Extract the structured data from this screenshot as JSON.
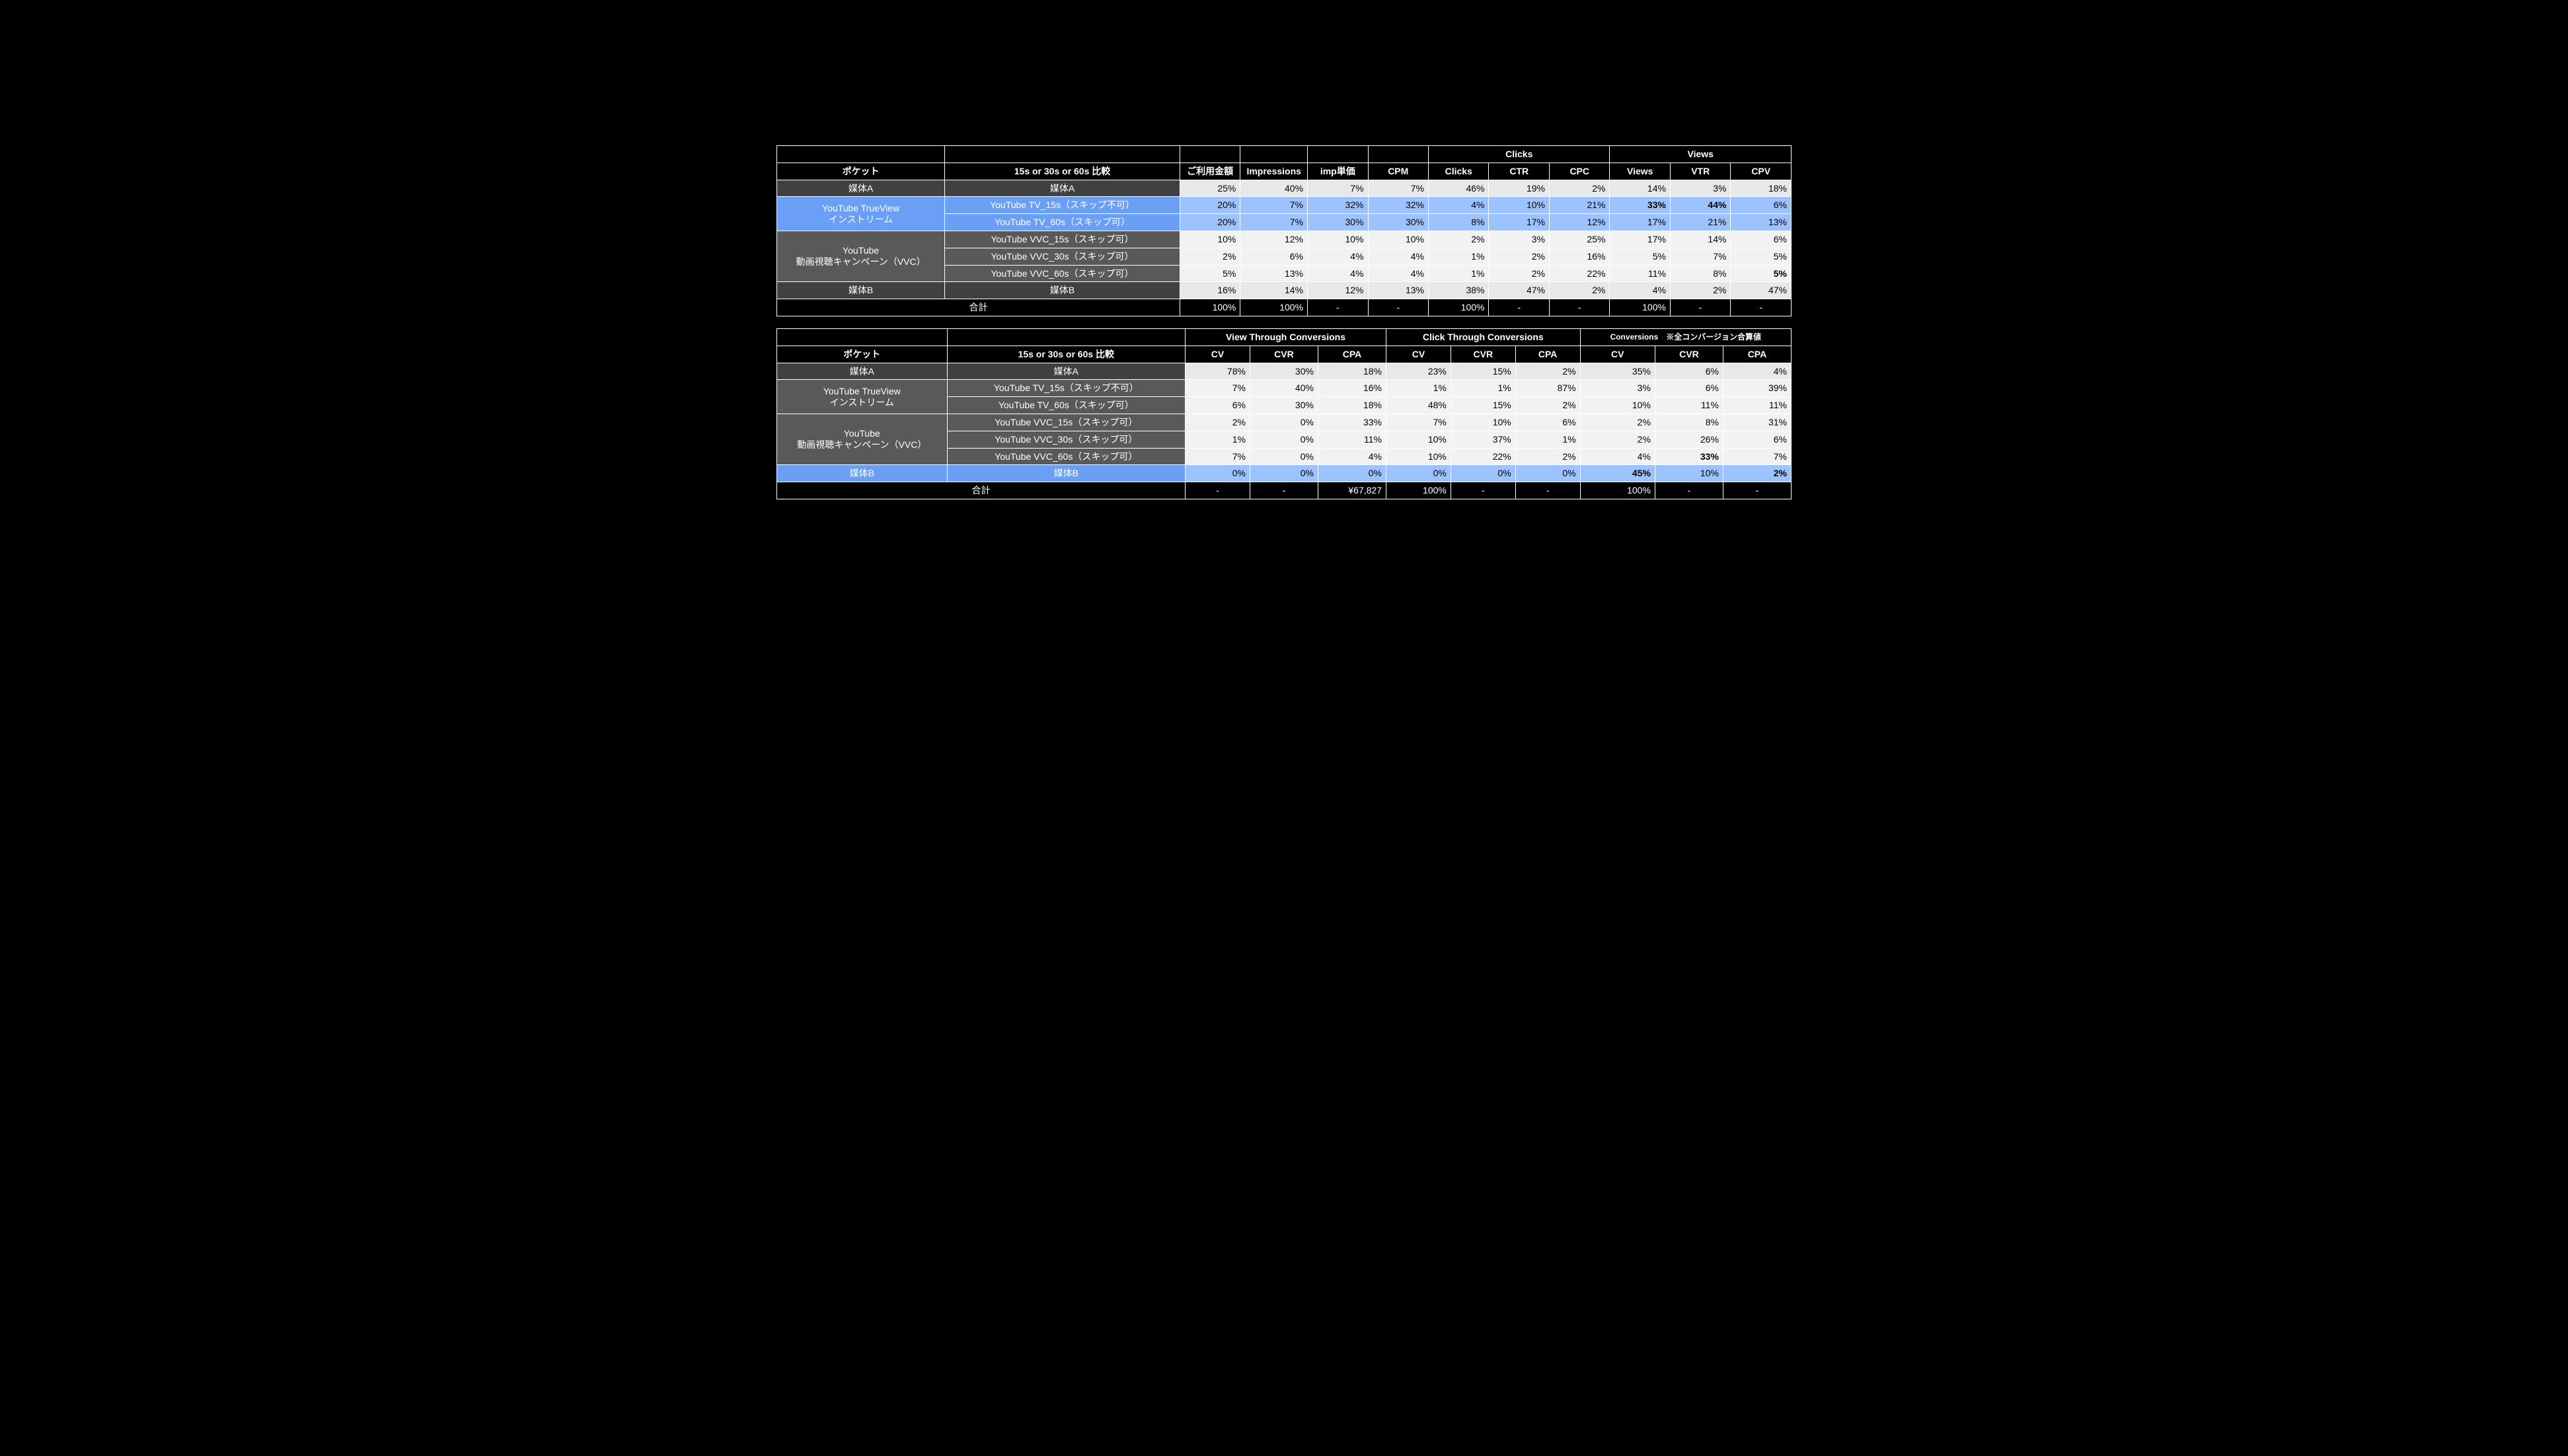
{
  "t1": {
    "group_clicks": "Clicks",
    "group_views": "Views",
    "hdr_pocket": "ポケット",
    "hdr_compare": "15s or 30s or 60s 比較",
    "cols": {
      "amount": "ご利用金額",
      "imp": "Impressions",
      "imp_unit": "imp単価",
      "cpm": "CPM",
      "clicks": "Clicks",
      "ctr": "CTR",
      "cpc": "CPC",
      "views": "Views",
      "vtr": "VTR",
      "cpv": "CPV"
    },
    "rows": {
      "a": {
        "rowhead": "媒体A",
        "subhead": "媒体A",
        "amount": "25%",
        "imp": "40%",
        "imp_unit": "7%",
        "cpm": "7%",
        "clicks": "46%",
        "ctr": "19%",
        "cpc": "2%",
        "views": "14%",
        "vtr": "3%",
        "cpv": "18%"
      },
      "tv": {
        "rowhead": "YouTube TrueView\nインストリーム",
        "r1": {
          "subhead": "YouTube TV_15s（スキップ不可）",
          "amount": "20%",
          "imp": "7%",
          "imp_unit": "32%",
          "cpm": "32%",
          "clicks": "4%",
          "ctr": "10%",
          "cpc": "21%",
          "views": "33%",
          "vtr": "44%",
          "cpv": "6%"
        },
        "r2": {
          "subhead": "YouTube TV_60s（スキップ可）",
          "amount": "20%",
          "imp": "7%",
          "imp_unit": "30%",
          "cpm": "30%",
          "clicks": "8%",
          "ctr": "17%",
          "cpc": "12%",
          "views": "17%",
          "vtr": "21%",
          "cpv": "13%"
        }
      },
      "vvc": {
        "rowhead": "YouTube\n動画視聴キャンペーン（VVC）",
        "r1": {
          "subhead": "YouTube VVC_15s（スキップ可）",
          "amount": "10%",
          "imp": "12%",
          "imp_unit": "10%",
          "cpm": "10%",
          "clicks": "2%",
          "ctr": "3%",
          "cpc": "25%",
          "views": "17%",
          "vtr": "14%",
          "cpv": "6%"
        },
        "r2": {
          "subhead": "YouTube VVC_30s（スキップ可）",
          "amount": "2%",
          "imp": "6%",
          "imp_unit": "4%",
          "cpm": "4%",
          "clicks": "1%",
          "ctr": "2%",
          "cpc": "16%",
          "views": "5%",
          "vtr": "7%",
          "cpv": "5%"
        },
        "r3": {
          "subhead": "YouTube VVC_60s（スキップ可）",
          "amount": "5%",
          "imp": "13%",
          "imp_unit": "4%",
          "cpm": "4%",
          "clicks": "1%",
          "ctr": "2%",
          "cpc": "22%",
          "views": "11%",
          "vtr": "8%",
          "cpv": "5%"
        }
      },
      "b": {
        "rowhead": "媒体B",
        "subhead": "媒体B",
        "amount": "16%",
        "imp": "14%",
        "imp_unit": "12%",
        "cpm": "13%",
        "clicks": "38%",
        "ctr": "47%",
        "cpc": "2%",
        "views": "4%",
        "vtr": "2%",
        "cpv": "47%"
      },
      "total": {
        "rowhead": "合計",
        "amount": "100%",
        "imp": "100%",
        "imp_unit": "-",
        "cpm": "-",
        "clicks": "100%",
        "ctr": "-",
        "cpc": "-",
        "views": "100%",
        "vtr": "-",
        "cpv": "-"
      }
    }
  },
  "t2": {
    "group_vtc": "View Through Conversions",
    "group_ctc": "Click Through Conversions",
    "group_conv": "Conversions　※全コンバージョン合算値",
    "hdr_pocket": "ポケット",
    "hdr_compare": "15s or 30s or 60s 比較",
    "cols": {
      "cv": "CV",
      "cvr": "CVR",
      "cpa": "CPA"
    },
    "rows": {
      "a": {
        "rowhead": "媒体A",
        "subhead": "媒体A",
        "vtc_cv": "78%",
        "vtc_cvr": "30%",
        "vtc_cpa": "18%",
        "ctc_cv": "23%",
        "ctc_cvr": "15%",
        "ctc_cpa": "2%",
        "cv": "35%",
        "cvr": "6%",
        "cpa": "4%"
      },
      "tv": {
        "rowhead": "YouTube TrueView\nインストリーム",
        "r1": {
          "subhead": "YouTube TV_15s（スキップ不可）",
          "vtc_cv": "7%",
          "vtc_cvr": "40%",
          "vtc_cpa": "16%",
          "ctc_cv": "1%",
          "ctc_cvr": "1%",
          "ctc_cpa": "87%",
          "cv": "3%",
          "cvr": "6%",
          "cpa": "39%"
        },
        "r2": {
          "subhead": "YouTube TV_60s（スキップ可）",
          "vtc_cv": "6%",
          "vtc_cvr": "30%",
          "vtc_cpa": "18%",
          "ctc_cv": "48%",
          "ctc_cvr": "15%",
          "ctc_cpa": "2%",
          "cv": "10%",
          "cvr": "11%",
          "cpa": "11%"
        }
      },
      "vvc": {
        "rowhead": "YouTube\n動画視聴キャンペーン（VVC）",
        "r1": {
          "subhead": "YouTube VVC_15s（スキップ可）",
          "vtc_cv": "2%",
          "vtc_cvr": "0%",
          "vtc_cpa": "33%",
          "ctc_cv": "7%",
          "ctc_cvr": "10%",
          "ctc_cpa": "6%",
          "cv": "2%",
          "cvr": "8%",
          "cpa": "31%"
        },
        "r2": {
          "subhead": "YouTube VVC_30s（スキップ可）",
          "vtc_cv": "1%",
          "vtc_cvr": "0%",
          "vtc_cpa": "11%",
          "ctc_cv": "10%",
          "ctc_cvr": "37%",
          "ctc_cpa": "1%",
          "cv": "2%",
          "cvr": "26%",
          "cpa": "6%"
        },
        "r3": {
          "subhead": "YouTube VVC_60s（スキップ可）",
          "vtc_cv": "7%",
          "vtc_cvr": "0%",
          "vtc_cpa": "4%",
          "ctc_cv": "10%",
          "ctc_cvr": "22%",
          "ctc_cpa": "2%",
          "cv": "4%",
          "cvr": "33%",
          "cpa": "7%"
        }
      },
      "b": {
        "rowhead": "媒体B",
        "subhead": "媒体B",
        "vtc_cv": "0%",
        "vtc_cvr": "0%",
        "vtc_cpa": "0%",
        "ctc_cv": "0%",
        "ctc_cvr": "0%",
        "ctc_cpa": "0%",
        "cv": "45%",
        "cvr": "10%",
        "cpa": "2%"
      },
      "total": {
        "rowhead": "合計",
        "vtc_cv": "-",
        "vtc_cvr": "-",
        "vtc_cpa": "¥67,827",
        "ctc_cv": "100%",
        "ctc_cvr": "-",
        "ctc_cpa": "-",
        "cv": "100%",
        "cvr": "-",
        "cpa": "-"
      }
    }
  }
}
